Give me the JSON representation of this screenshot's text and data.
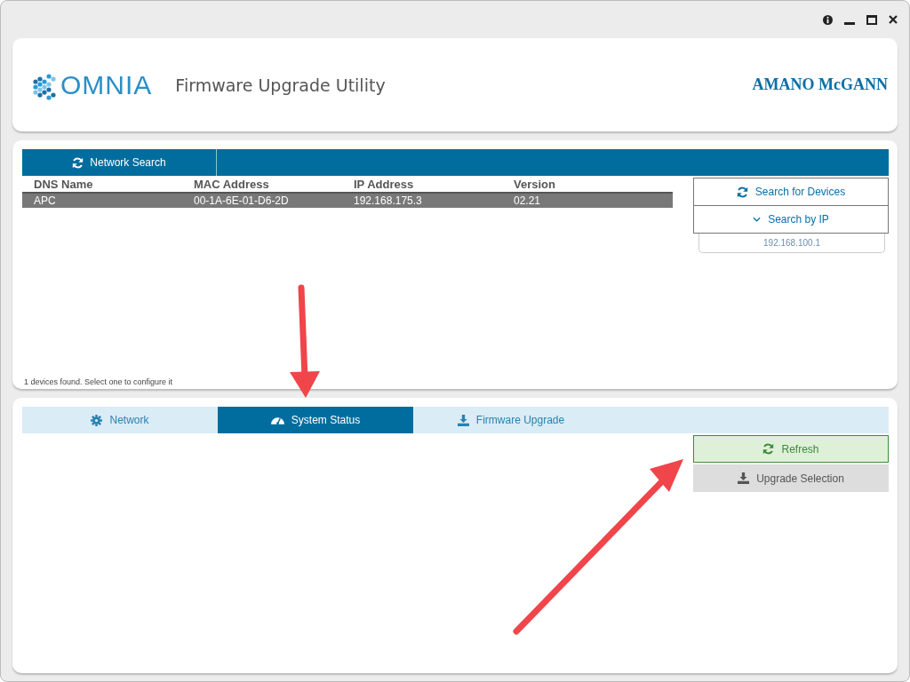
{
  "header": {
    "logo_text": "OMNIA",
    "title": "Firmware Upgrade Utility",
    "brand": "AMANO McGANN"
  },
  "network_tab": {
    "label": "Network Search"
  },
  "table": {
    "columns": [
      "DNS Name",
      "MAC Address",
      "IP Address",
      "Version"
    ],
    "rows": [
      {
        "cells": [
          "APC",
          "00-1A-6E-01-D6-2D",
          "192.168.175.3",
          "02.21"
        ],
        "selected": true
      }
    ]
  },
  "search_buttons": [
    {
      "label": "Search for Devices",
      "kind": "refresh"
    },
    {
      "label": "Search by IP",
      "kind": "chevron"
    }
  ],
  "ip_field": {
    "value": "192.168.100.1"
  },
  "status": "1 devices found. Select one to configure it",
  "tabs": [
    {
      "label": "Network",
      "kind": "gear",
      "selected": false
    },
    {
      "label": "System Status",
      "kind": "gauge",
      "selected": true
    },
    {
      "label": "Firmware Upgrade",
      "kind": "download",
      "selected": false
    }
  ],
  "actions": [
    {
      "label": "Refresh",
      "kind": "refresh",
      "disabled": false
    },
    {
      "label": "Upgrade Selection",
      "kind": "download",
      "disabled": true
    }
  ]
}
